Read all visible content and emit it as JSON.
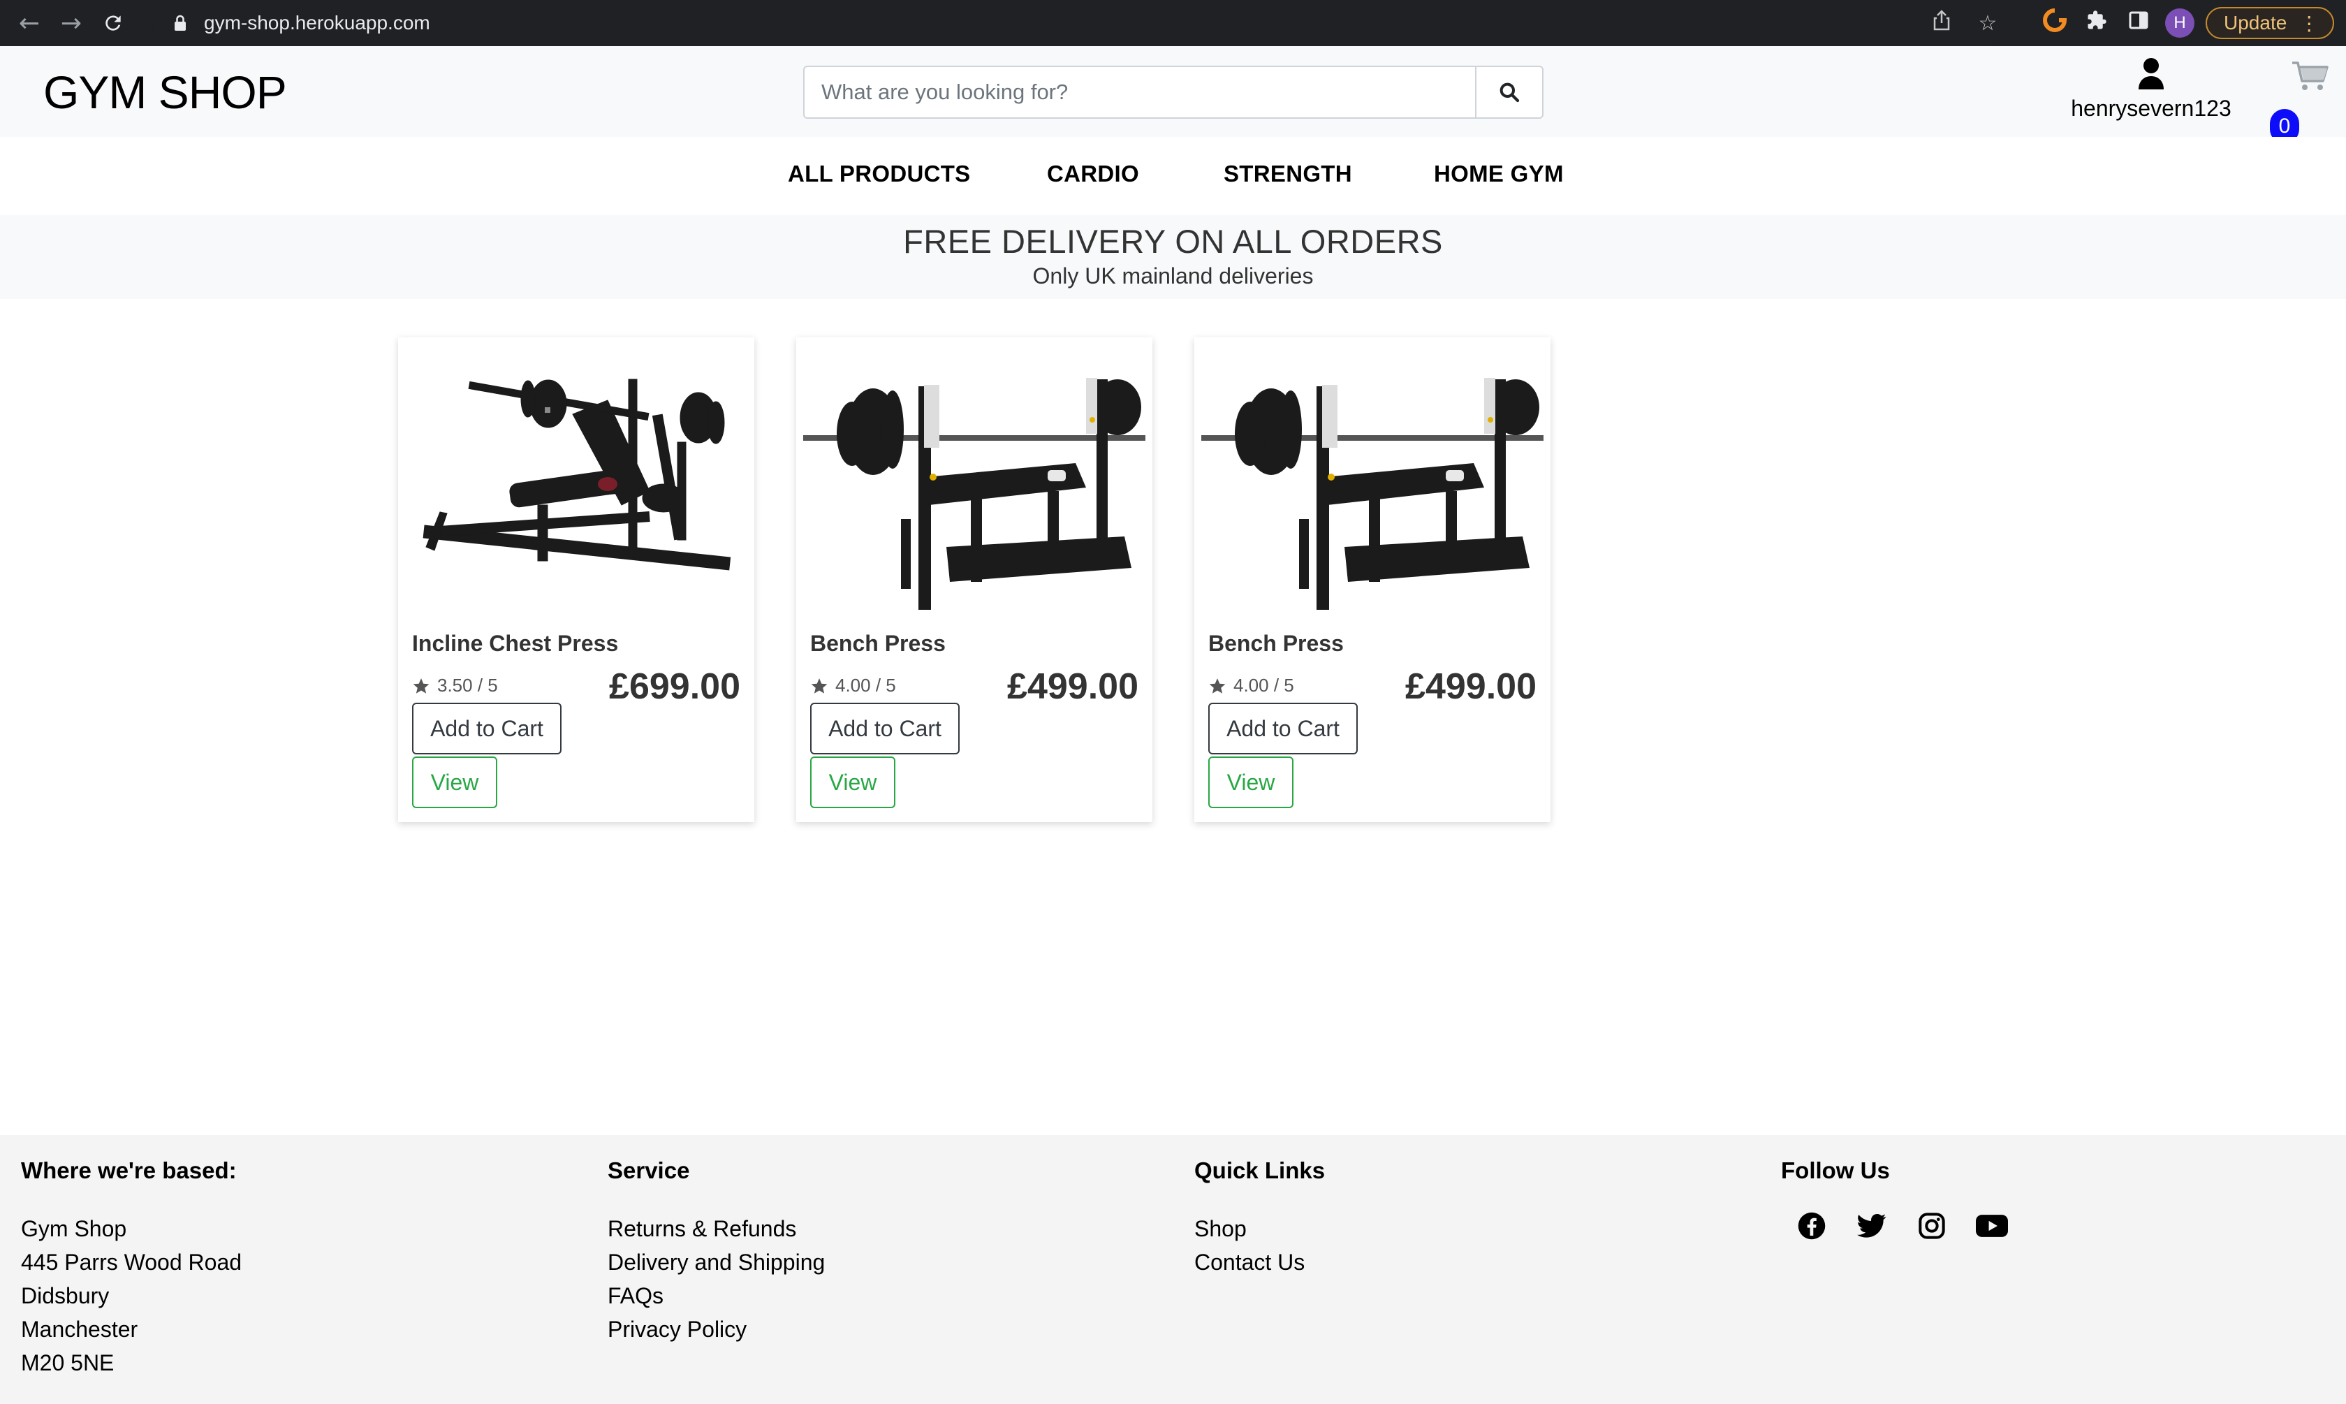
{
  "browser": {
    "url": "gym-shop.herokuapp.com",
    "update_label": "Update",
    "profile_initial": "H"
  },
  "header": {
    "logo": "GYM SHOP",
    "search_placeholder": "What are you looking for?",
    "username": "henrysevern123",
    "cart_count": "0"
  },
  "nav": {
    "items": [
      "ALL PRODUCTS",
      "CARDIO",
      "STRENGTH",
      "HOME GYM"
    ]
  },
  "banner": {
    "title": "FREE DELIVERY ON ALL ORDERS",
    "subtitle": "Only UK mainland deliveries"
  },
  "products": [
    {
      "name": "Incline Chest Press",
      "rating": "3.50 / 5",
      "price": "£699.00",
      "add_label": "Add to Cart",
      "view_label": "View"
    },
    {
      "name": "Bench Press",
      "rating": "4.00 / 5",
      "price": "£499.00",
      "add_label": "Add to Cart",
      "view_label": "View"
    },
    {
      "name": "Bench Press",
      "rating": "4.00 / 5",
      "price": "£499.00",
      "add_label": "Add to Cart",
      "view_label": "View"
    }
  ],
  "footer": {
    "based": {
      "heading": "Where we're based:",
      "lines": [
        "Gym Shop",
        "445 Parrs Wood Road",
        "Didsbury",
        "Manchester",
        "M20 5NE"
      ]
    },
    "service": {
      "heading": "Service",
      "links": [
        "Returns & Refunds",
        "Delivery and Shipping",
        "FAQs",
        "Privacy Policy"
      ]
    },
    "quick_links": {
      "heading": "Quick Links",
      "links": [
        "Shop",
        "Contact Us"
      ]
    },
    "follow": {
      "heading": "Follow Us",
      "icons": [
        "facebook-icon",
        "twitter-icon",
        "instagram-icon",
        "youtube-icon"
      ]
    }
  },
  "colors": {
    "green": "#28a745",
    "badge_blue": "#0d0dfa",
    "header_bg": "#f8f9fa",
    "footer_bg": "#f4f4f4"
  }
}
